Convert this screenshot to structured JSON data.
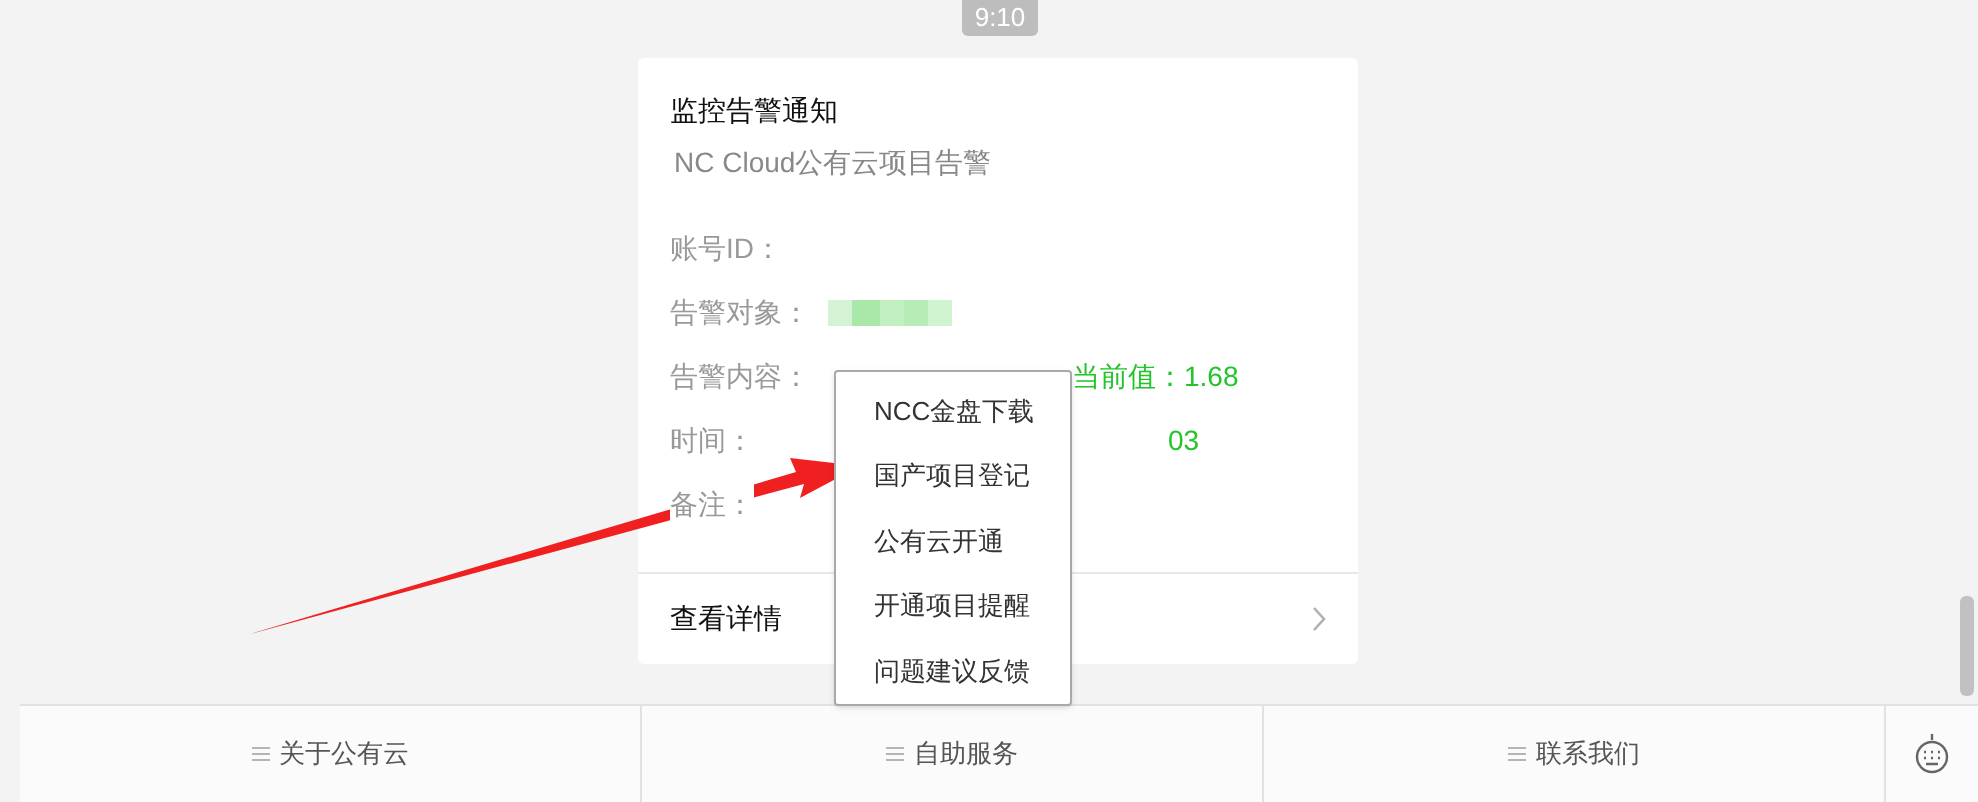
{
  "timestamp": "9:10",
  "card": {
    "title": "监控告警通知",
    "subtitle": "NC Cloud公有云项目告警",
    "fields": [
      {
        "label": "账号ID：",
        "kind": "text"
      },
      {
        "label": "告警对象：",
        "kind": "redacted"
      },
      {
        "label": "告警内容：",
        "kind": "text",
        "value": "当前值：1.68"
      },
      {
        "label": "时间：",
        "kind": "text",
        "value": "03"
      },
      {
        "label": "备注：",
        "kind": "text"
      }
    ],
    "footer": "查看详情"
  },
  "popup_menu": [
    {
      "label": "NCC金盘下载"
    },
    {
      "label": "国产项目登记"
    },
    {
      "label": "公有云开通"
    },
    {
      "label": "开通项目提醒"
    },
    {
      "label": "问题建议反馈"
    }
  ],
  "bottom_menu": [
    {
      "label": "关于公有云"
    },
    {
      "label": "自助服务"
    },
    {
      "label": "联系我们"
    }
  ]
}
